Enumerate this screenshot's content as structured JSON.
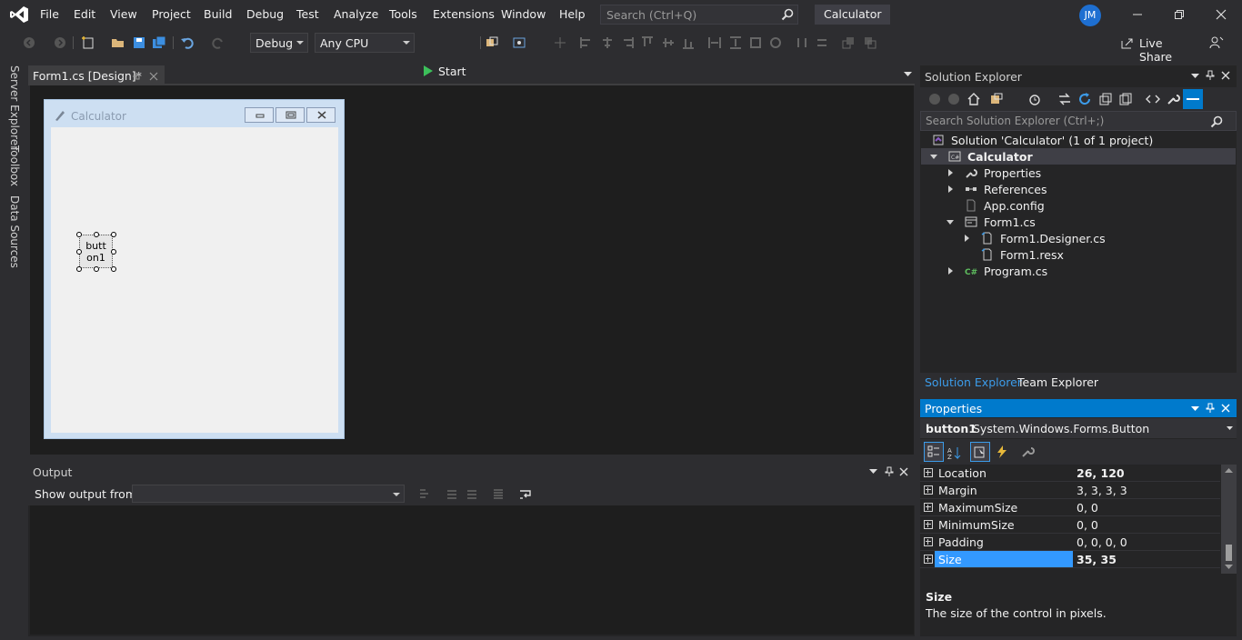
{
  "menu": [
    "File",
    "Edit",
    "View",
    "Project",
    "Build",
    "Debug",
    "Test",
    "Analyze",
    "Tools",
    "Extensions",
    "Window",
    "Help"
  ],
  "search": {
    "placeholder": "Search (Ctrl+Q)"
  },
  "solution_name": "Calculator",
  "user_initials": "JM",
  "toolbar": {
    "config": "Debug",
    "platform": "Any CPU",
    "start_label": "Start",
    "live_share": "Live Share"
  },
  "left_tabs": [
    "Server Explorer",
    "Toolbox",
    "Data Sources"
  ],
  "doc_tab": {
    "label": "Form1.cs [Design]*"
  },
  "form": {
    "title": "Calculator",
    "button_text_line1": "butt",
    "button_text_line2": "on1"
  },
  "output": {
    "title": "Output",
    "show_from_label": "Show output from:",
    "show_from_value": ""
  },
  "solution_explorer": {
    "title": "Solution Explorer",
    "search_placeholder": "Search Solution Explorer (Ctrl+;)",
    "tree": [
      {
        "label": "Solution 'Calculator' (1 of 1 project)"
      },
      {
        "label": "Calculator"
      },
      {
        "label": "Properties"
      },
      {
        "label": "References"
      },
      {
        "label": "App.config"
      },
      {
        "label": "Form1.cs"
      },
      {
        "label": "Form1.Designer.cs"
      },
      {
        "label": "Form1.resx"
      },
      {
        "label": "Program.cs"
      }
    ],
    "tabs": [
      "Solution Explorer",
      "Team Explorer"
    ]
  },
  "properties": {
    "title": "Properties",
    "object_name": "button1",
    "object_type": "System.Windows.Forms.Button",
    "rows": [
      {
        "name": "Location",
        "value": "26, 120"
      },
      {
        "name": "Margin",
        "value": "3, 3, 3, 3"
      },
      {
        "name": "MaximumSize",
        "value": "0, 0"
      },
      {
        "name": "MinimumSize",
        "value": "0, 0"
      },
      {
        "name": "Padding",
        "value": "0, 0, 0, 0"
      },
      {
        "name": "Size",
        "value": "35, 35"
      }
    ],
    "desc_title": "Size",
    "desc_text": "The size of the control in pixels."
  },
  "colors": {
    "accent": "#007acc",
    "vs_purple": "#68217a",
    "bg": "#2d2d30"
  }
}
